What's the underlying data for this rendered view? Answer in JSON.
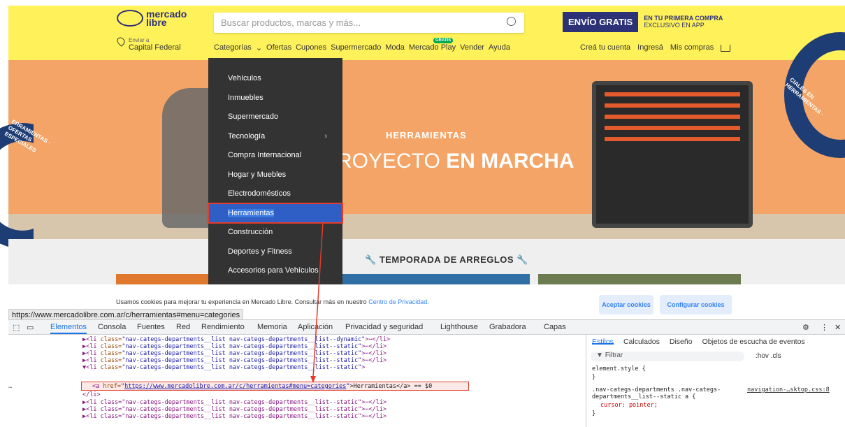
{
  "header": {
    "logo_line1": "mercado",
    "logo_line2": "libre",
    "search_placeholder": "Buscar productos, marcas y más...",
    "promo_big": "ENVÍO GRATIS",
    "promo_small1": "EN TU PRIMERA COMPRA",
    "promo_small2": "EXCLUSIVO EN APP",
    "loc_small": "Enviar a",
    "loc": "Capital Federal",
    "nav": [
      "Categorías",
      "Ofertas",
      "Cupones",
      "Supermercado",
      "Moda",
      "Mercado Play",
      "Vender",
      "Ayuda"
    ],
    "gratis": "GRATIS",
    "account": [
      "Creá tu cuenta",
      "Ingresá",
      "Mis compras"
    ]
  },
  "banner": {
    "title": "HERRAMIENTAS",
    "main_light": "ROYECTO",
    "main_bold": "EN MARCHA",
    "left_text": "ERRAMIENTAS · OFERTAS ESPECIALES",
    "right_text": "CIALES EN HERRAMIENTAS ·"
  },
  "subbanner": {
    "title": "TEMPORADA DE ARREGLOS"
  },
  "dropdown": {
    "items": [
      "Vehículos",
      "Inmuebles",
      "Supermercado",
      "Tecnología",
      "Compra Internacional",
      "Hogar y Muebles",
      "Electrodomésticos",
      "Herramientas",
      "Construcción",
      "Deportes y Fitness",
      "Accesorios para Vehículos"
    ]
  },
  "cookie": {
    "msg": "Usamos cookies para mejorar tu experiencia en Mercado Libre. Consultar más en nuestro",
    "link": "Centro de Privacidad.",
    "accept": "Aceptar cookies",
    "config": "Configurar cookies"
  },
  "status_url": "https://www.mercadolibre.com.ar/c/herramientas#menu=categories",
  "devtools": {
    "tabs": [
      "Elementos",
      "Consola",
      "Fuentes",
      "Red",
      "Rendimiento",
      "Memoria",
      "Aplicación",
      "Privacidad y seguridad",
      "Lighthouse",
      "Grabadora",
      "Capas"
    ],
    "styles_tabs": [
      "Estilos",
      "Calculados",
      "Diseño",
      "Objetos de escucha de eventos"
    ],
    "filter": "Filtrar",
    "hov": ":hov .cls",
    "element_style": "element.style {",
    "close_brace": "}",
    "rule_sel": ".nav-categs-departments .nav-categs-",
    "rule_sel2": "departments__list--static a {",
    "rule_src": "navigation-…sktop.css:8",
    "rule_prop": "cursor: pointer;",
    "code": [
      {
        "pre": "▶<li ",
        "attr": "class=",
        "val": "\"nav-categs-departments__list nav-categs-departments__list--dynamic\"",
        "post": ">⋯</li>"
      },
      {
        "pre": "▶<li ",
        "attr": "class=",
        "val": "\"nav-categs-departments__list nav-categs-departments__list--static\"",
        "post": ">⋯</li>"
      },
      {
        "pre": "▶<li ",
        "attr": "class=",
        "val": "\"nav-categs-departments__list nav-categs-departments__list--static\"",
        "post": ">⋯</li>"
      },
      {
        "pre": "▶<li ",
        "attr": "class=",
        "val": "\"nav-categs-departments__list nav-categs-departments__list--static\"",
        "post": ">⋯</li>"
      },
      {
        "pre": "▼<li ",
        "attr": "class=",
        "val": "\"nav-categs-departments__list nav-categs-departments__list--static\"",
        "post": ">"
      }
    ],
    "a_line": {
      "pre": "<a ",
      "attr": "href=",
      "href": "https://www.mercadolibre.com.ar/c/herramientas#menu=categories",
      "text": ">Herramientas</a> == $0"
    },
    "li_close": "</li>",
    "code2": [
      "▶<li class=\"nav-categs-departments__list nav-categs-departments__list--static\">⋯</li>",
      "▶<li class=\"nav-categs-departments__list nav-categs-departments__list--static\">⋯</li>",
      "▶<li class=\"nav-categs-departments__list nav-categs-departments__list--static\">⋯</li>"
    ]
  }
}
